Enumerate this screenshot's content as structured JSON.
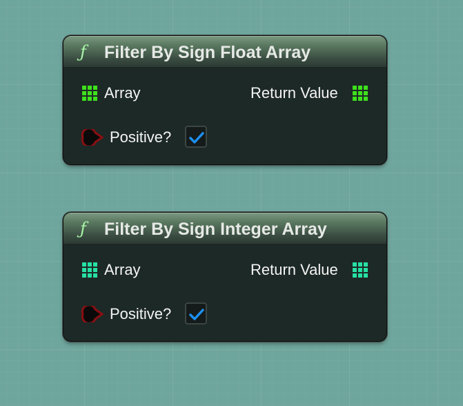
{
  "nodes": [
    {
      "title": "Filter By Sign Float Array",
      "function_icon": "ƒ",
      "input_array_label": "Array",
      "return_value_label": "Return Value",
      "positive_label": "Positive?",
      "positive_checked": true,
      "pin_color": "#3ee01c"
    },
    {
      "title": "Filter By Sign Integer Array",
      "function_icon": "ƒ",
      "input_array_label": "Array",
      "return_value_label": "Return Value",
      "positive_label": "Positive?",
      "positive_checked": true,
      "pin_color": "#27e0a4"
    }
  ],
  "colors": {
    "background": "#6ea59c",
    "node_body": "#1d2926",
    "bool_pin": "#8a0f12",
    "checkmark": "#1d8ff0"
  }
}
